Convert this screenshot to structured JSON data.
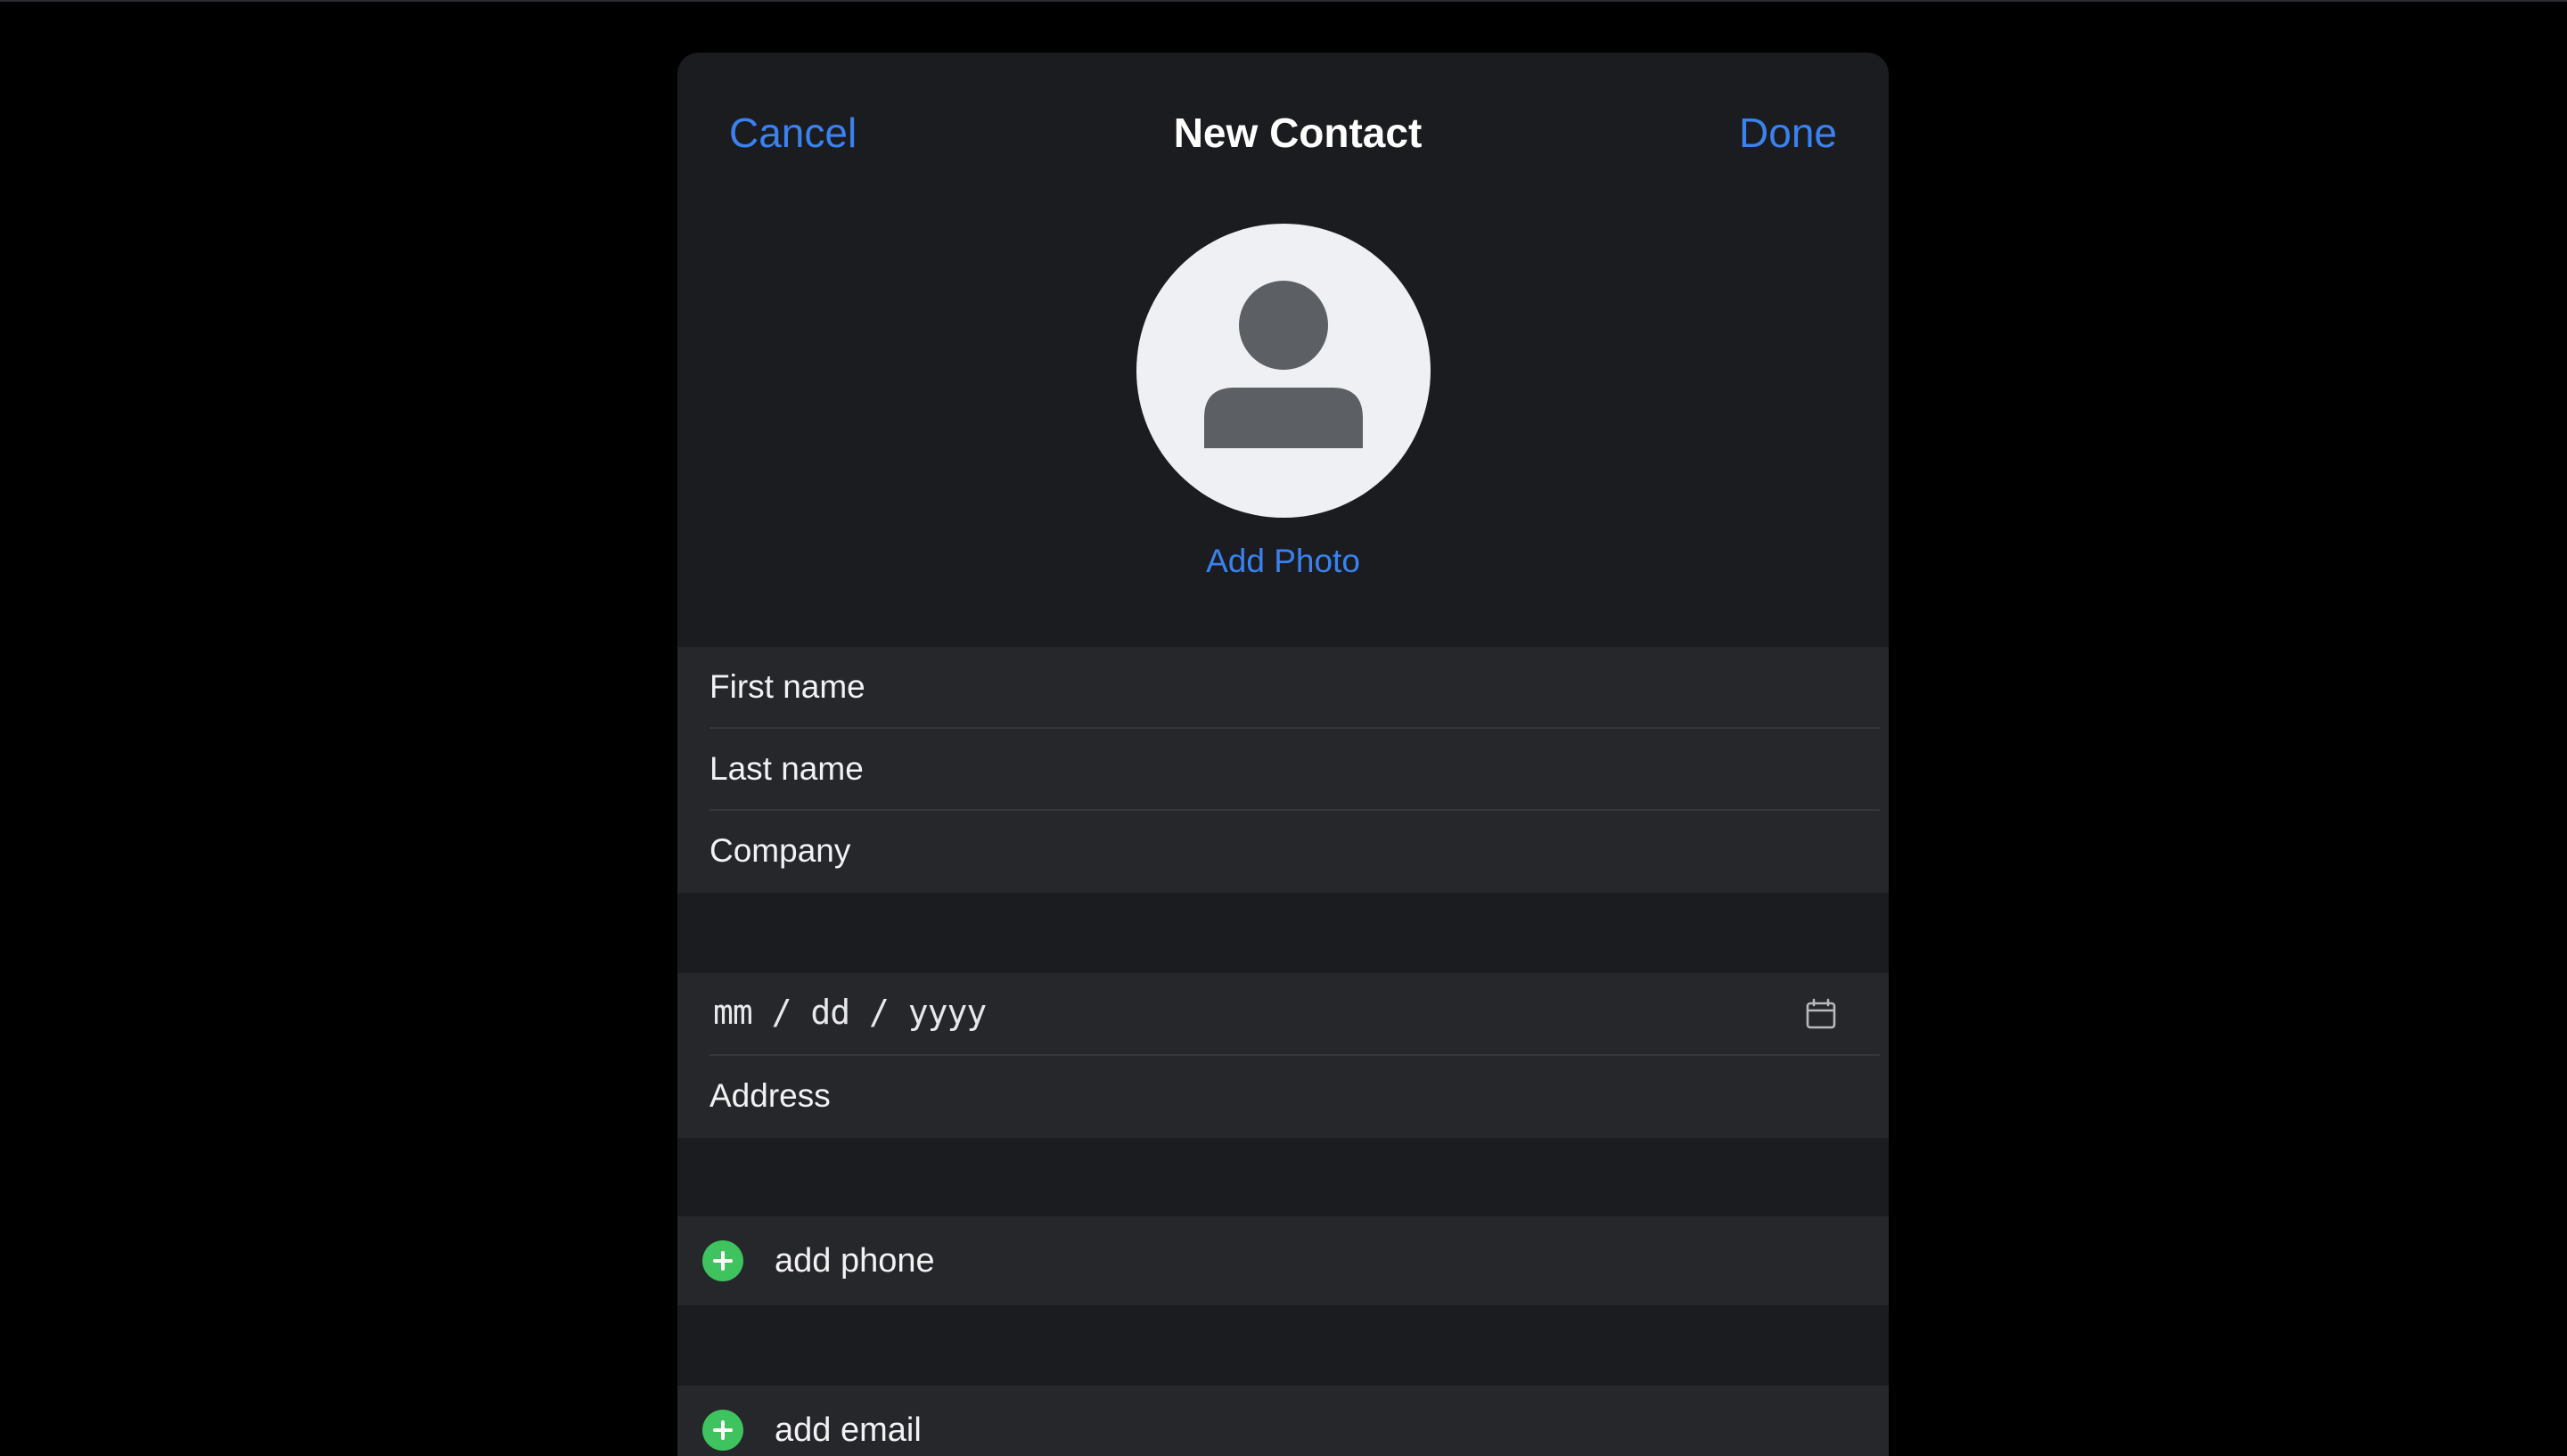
{
  "nav": {
    "cancel_label": "Cancel",
    "title": "New Contact",
    "done_label": "Done"
  },
  "photo": {
    "add_label": "Add Photo"
  },
  "name_fields": {
    "first_name": "First name",
    "last_name": "Last name",
    "company": "Company"
  },
  "details": {
    "date_placeholder": "mm / dd / yyyy",
    "address": "Address"
  },
  "actions": {
    "add_phone": "add phone",
    "add_email": "add email"
  },
  "icons": {
    "avatar": "person-silhouette-icon",
    "calendar": "calendar-icon",
    "add": "plus-circle-icon"
  },
  "colors": {
    "accent": "#3a82f0",
    "add_green": "#3ec35e",
    "sheet_bg": "#1b1c1f",
    "group_bg": "#26272b"
  }
}
